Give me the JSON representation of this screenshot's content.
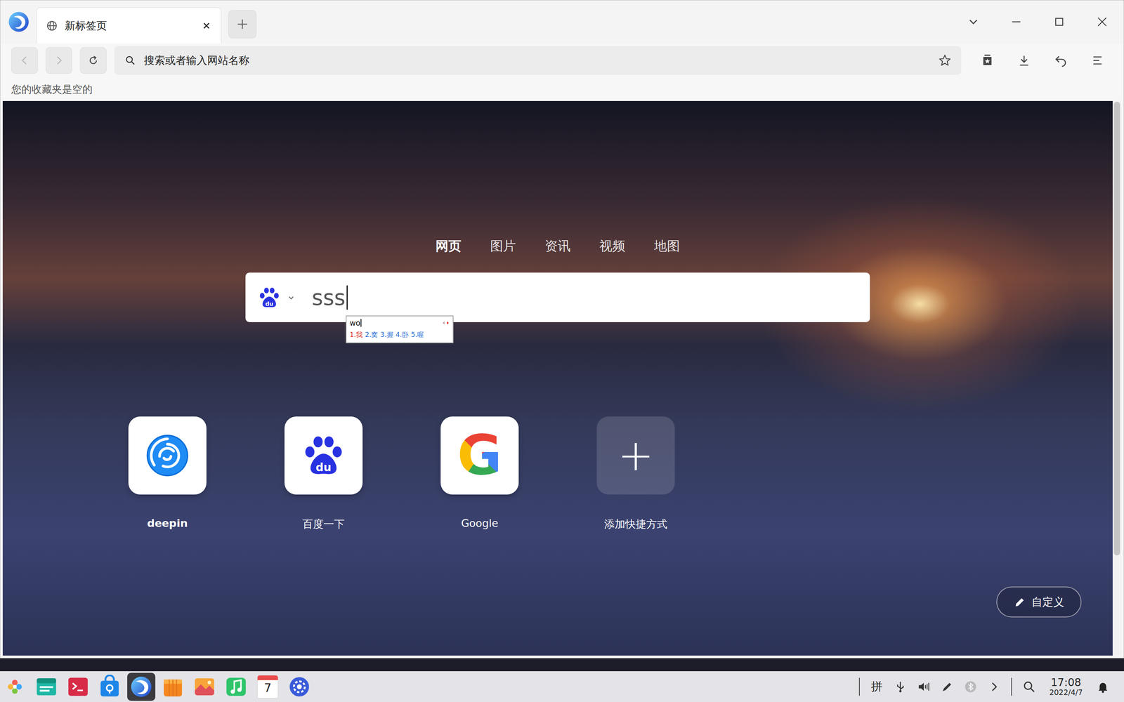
{
  "tabs": [
    {
      "label": "新标签页",
      "selected": true
    }
  ],
  "navigation": {
    "back_enabled": false,
    "forward_enabled": false
  },
  "address_bar": {
    "placeholder": "搜索或者输入网站名称",
    "bookmarked": false
  },
  "bookmarks_bar": {
    "empty_text": "您的收藏夹是空的"
  },
  "search": {
    "categories": [
      {
        "label": "网页",
        "selected": true
      },
      {
        "label": "图片",
        "selected": false
      },
      {
        "label": "资讯",
        "selected": false
      },
      {
        "label": "视频",
        "selected": false
      },
      {
        "label": "地图",
        "selected": false
      }
    ],
    "engine_logo": "du",
    "value": "sss"
  },
  "ime": {
    "composition": "wo",
    "candidates": [
      {
        "text": "1.我",
        "selected": true
      },
      {
        "text": "2.窝",
        "selected": false
      },
      {
        "text": "3.握",
        "selected": false
      },
      {
        "text": "4.卧",
        "selected": false
      },
      {
        "text": "5.喔",
        "selected": false
      }
    ]
  },
  "shortcuts": [
    {
      "label": "deepin",
      "kind": "deepin",
      "logo_text": ""
    },
    {
      "label": "百度一下",
      "kind": "baidu",
      "logo_text": "du"
    },
    {
      "label": "Google",
      "kind": "google",
      "logo_text": "G"
    },
    {
      "label": "添加快捷方式",
      "kind": "add",
      "logo_text": "+"
    }
  ],
  "customize_button": {
    "label": "自定义"
  },
  "scrollbar": {
    "level": 0.82
  },
  "taskbar": {
    "apps": [
      {
        "kind": "launcher",
        "active": false
      },
      {
        "kind": "files",
        "active": false
      },
      {
        "kind": "terminal",
        "active": false
      },
      {
        "kind": "appstore",
        "active": false
      },
      {
        "kind": "browser",
        "active": true
      },
      {
        "kind": "shop",
        "active": false
      },
      {
        "kind": "photos",
        "active": false
      },
      {
        "kind": "music",
        "active": false
      },
      {
        "kind": "calendar",
        "active": false
      },
      {
        "kind": "settings",
        "active": false
      }
    ],
    "calendar_day": "7",
    "tray": {
      "ime": "拼",
      "bluetooth_on": false
    },
    "clock": {
      "time": "17:08",
      "date": "2022/4/7"
    }
  }
}
